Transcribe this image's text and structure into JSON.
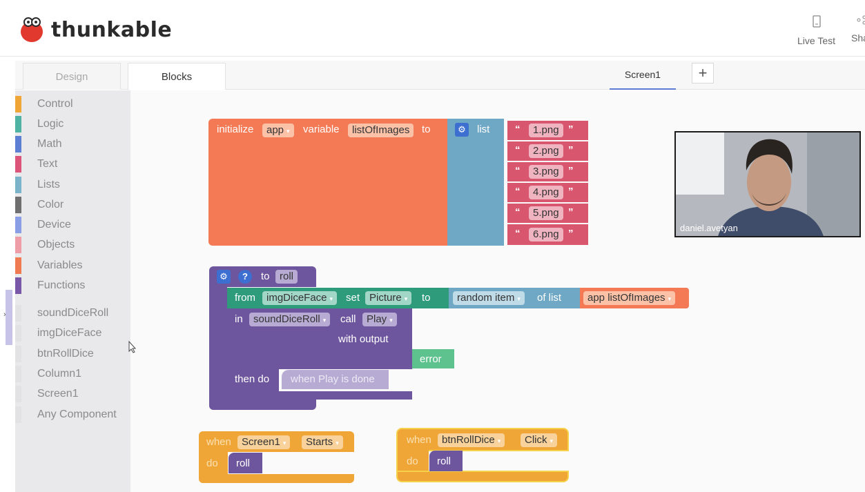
{
  "header": {
    "logo_text": "thunkable",
    "live_test_label": "Live Test",
    "share_label": "Sha",
    "live_test_icon": "phone-icon",
    "share_icon": "share-icon"
  },
  "tabs": {
    "design_label": "Design",
    "blocks_label": "Blocks",
    "screen_label": "Screen1",
    "add_label": "+"
  },
  "sidebar": {
    "categories": [
      {
        "label": "Control",
        "color": "#f0a637"
      },
      {
        "label": "Logic",
        "color": "#4eb3a2"
      },
      {
        "label": "Math",
        "color": "#5c7fd3"
      },
      {
        "label": "Text",
        "color": "#dc5479"
      },
      {
        "label": "Lists",
        "color": "#7bb4c9"
      },
      {
        "label": "Color",
        "color": "#6f6f6f"
      },
      {
        "label": "Device",
        "color": "#8a9ee6"
      },
      {
        "label": "Objects",
        "color": "#ee9da7"
      },
      {
        "label": "Variables",
        "color": "#f07a52"
      },
      {
        "label": "Functions",
        "color": "#7958a8"
      }
    ],
    "components": [
      {
        "label": "soundDiceRoll"
      },
      {
        "label": "imgDiceFace"
      },
      {
        "label": "btnRollDice"
      },
      {
        "label": "Column1"
      },
      {
        "label": "Screen1"
      },
      {
        "label": "Any Component"
      }
    ]
  },
  "blocks": {
    "init": {
      "initialize": "initialize",
      "app": "app",
      "variable": "variable",
      "var_name": "listOfImages",
      "to": "to",
      "list": "list",
      "items": [
        "1.png",
        "2.png",
        "3.png",
        "4.png",
        "5.png",
        "6.png"
      ],
      "open_quote": "“",
      "close_quote": "”"
    },
    "func": {
      "to": "to",
      "name": "roll",
      "from": "from",
      "component": "imgDiceFace",
      "set": "set",
      "property": "Picture",
      "to2": "to",
      "random_item": "random item",
      "of_list": "of list",
      "app_var": "app listOfImages",
      "in": "in",
      "sound": "soundDiceRoll",
      "call": "call",
      "method": "Play",
      "with_output": "with output",
      "error": "error",
      "then_do": "then do",
      "when_done": "when Play is done"
    },
    "screen_event": {
      "when": "when",
      "component": "Screen1",
      "event": "Starts",
      "do": "do",
      "call": "roll"
    },
    "btn_event": {
      "when": "when",
      "component": "btnRollDice",
      "event": "Click",
      "do": "do",
      "call": "roll"
    }
  },
  "webcam": {
    "name": "daniel.avetyan"
  },
  "colors": {
    "variables": "#f37a54",
    "lists": "#6fa8c4",
    "text": "#d9566f",
    "functions": "#6e569f",
    "logic": "#2e9b7b",
    "control": "#f0a637",
    "error_green": "#5ec28e"
  }
}
